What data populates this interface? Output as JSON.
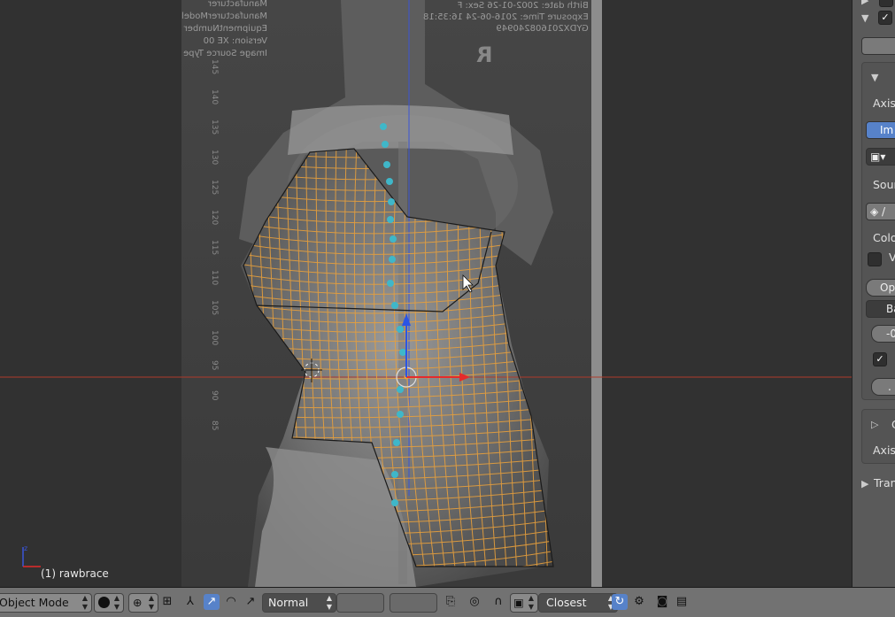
{
  "viewport": {
    "object_label": "(1) rawbrace",
    "xray_text": {
      "left_block": [
        "Manufacturer",
        "ManufacturerModel",
        "EquipmentNumber",
        "Version: XE 00",
        "Image Source Type"
      ],
      "right_block": [
        "Birth date: 2002-01-26 Sex: F",
        "Exposure Time: 2016-06-24 16:35:18",
        "GYDX201608240949"
      ],
      "marker": "R",
      "ruler_numbers": [
        "145",
        "140",
        "135",
        "130",
        "125",
        "120",
        "115",
        "110",
        "105",
        "100",
        "95",
        "90",
        "85"
      ]
    },
    "colors": {
      "mesh": "#e8a03c",
      "x_axis": "#e52b2b",
      "y_axis": "#2b55e5",
      "spine_dots": "#3fb7c9"
    }
  },
  "properties_panel": {
    "axis_label": "Axis",
    "image_button": "Im",
    "source_label": "Sour",
    "color_label": "Colo",
    "v_label": "V",
    "options_button": "Op",
    "ba_button": "Ba",
    "field1": "-0",
    "field2": ".",
    "sub_label": "C",
    "axis_label_2": "Axis",
    "transform_label": "Tran"
  },
  "header": {
    "mode": "Object Mode",
    "orientation": "Normal",
    "snap_target": "Closest"
  },
  "icons": {
    "mode_arrows": "updown-arrows-icon",
    "shading": "solid-sphere-icon",
    "pivot": "pivot-point-icon",
    "manipulator": "manipulator-icon",
    "translate": "translate-icon",
    "rotate": "rotate-icon",
    "scale": "scale-icon",
    "layers": "layers-icon",
    "lock": "lock-icon",
    "proportional": "proportional-edit-icon",
    "snap": "magnet-icon",
    "render": "camera-icon",
    "anim_render": "clapper-icon"
  }
}
